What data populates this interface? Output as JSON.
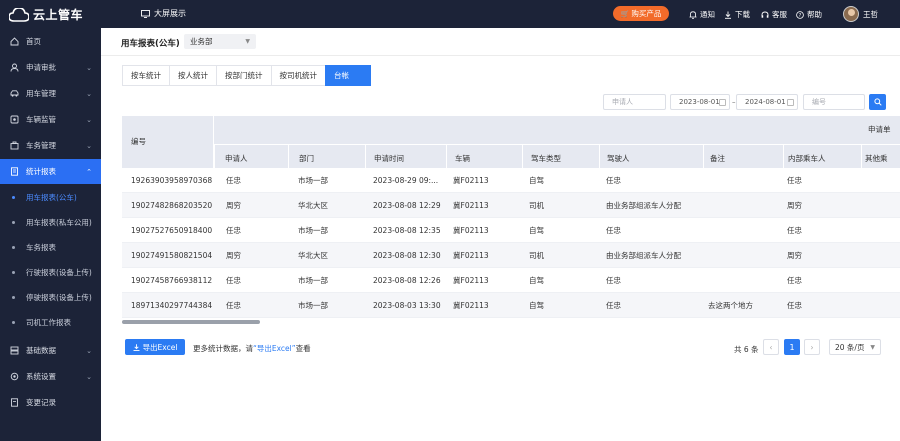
{
  "topbar": {
    "logo_text": "云上管车",
    "bigscreen": "大屏展示",
    "buy_button": "购买产品",
    "notify": "通知",
    "download": "下载",
    "service": "客服",
    "help": "帮助",
    "user_name": "王哲"
  },
  "sidebar": {
    "items": [
      {
        "label": "首页"
      },
      {
        "label": "申请审批"
      },
      {
        "label": "用车管理"
      },
      {
        "label": "车辆监管"
      },
      {
        "label": "车务管理"
      },
      {
        "label": "统计报表"
      },
      {
        "label": "基础数据"
      },
      {
        "label": "系统设置"
      },
      {
        "label": "变更记录"
      }
    ],
    "sub_items": [
      {
        "label": "用车报表(公车)"
      },
      {
        "label": "用车报表(私车公用)"
      },
      {
        "label": "车务报表"
      },
      {
        "label": "行驶报表(设备上传)"
      },
      {
        "label": "停驶报表(设备上传)"
      },
      {
        "label": "司机工作报表"
      }
    ]
  },
  "header": {
    "title": "用车报表(公车)",
    "dept_select": "业务部"
  },
  "tabs": [
    {
      "label": "按车统计"
    },
    {
      "label": "按人统计"
    },
    {
      "label": "按部门统计"
    },
    {
      "label": "按司机统计"
    },
    {
      "label": "台帐"
    }
  ],
  "filters": {
    "applicant_placeholder": "申请人",
    "start_date": "2023-08-01",
    "end_date": "2024-08-01",
    "range_sep": "–",
    "id_placeholder": "编号"
  },
  "table": {
    "id_header": "编号",
    "group_header": "申请单",
    "columns": [
      "申请人",
      "部门",
      "申请时间",
      "车辆",
      "驾车类型",
      "驾驶人",
      "备注",
      "内部乘车人",
      "其他乘"
    ],
    "rows": [
      [
        "19263903958970368",
        "任忠",
        "市场一部",
        "2023-08-29 09:...",
        "冀F02113",
        "自驾",
        "任忠",
        "",
        "任忠"
      ],
      [
        "19027482868203520",
        "周穷",
        "华北大区",
        "2023-08-08 12:29",
        "冀F02113",
        "司机",
        "由业务部组派车人分配",
        "",
        "周穷"
      ],
      [
        "19027527650918400",
        "任忠",
        "市场一部",
        "2023-08-08 12:35",
        "冀F02113",
        "自驾",
        "任忠",
        "",
        "任忠"
      ],
      [
        "19027491580821504",
        "周穷",
        "华北大区",
        "2023-08-08 12:30",
        "冀F02113",
        "司机",
        "由业务部组派车人分配",
        "",
        "周穷"
      ],
      [
        "19027458766938112",
        "任忠",
        "市场一部",
        "2023-08-08 12:26",
        "冀F02113",
        "自驾",
        "任忠",
        "",
        "任忠"
      ],
      [
        "18971340297744384",
        "任忠",
        "市场一部",
        "2023-08-03 13:30",
        "冀F02113",
        "自驾",
        "任忠",
        "去这两个地方",
        "任忠"
      ]
    ]
  },
  "footer": {
    "export_button": "导出Excel",
    "hint_prefix": "更多统计数据，请",
    "hint_link": "“导出Excel”",
    "hint_suffix": "查看",
    "total": "共 6 条",
    "current_page": "1",
    "page_size": "20 条/页"
  },
  "colors": {
    "nav_bg": "#1c2338",
    "accent": "#2b7bf3",
    "buy_orange": "#f26b2a"
  }
}
